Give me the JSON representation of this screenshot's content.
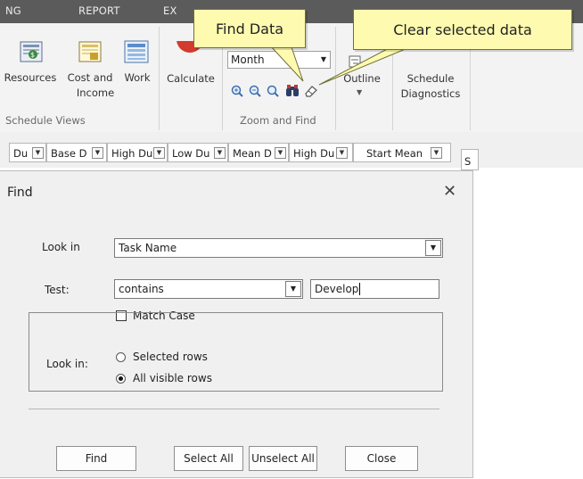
{
  "ribbon": {
    "tabs": [
      "NG",
      "REPORT",
      "EX"
    ],
    "buttons": {
      "resources": "Resources",
      "cost_income_line1": "Cost and",
      "cost_income_line2": "Income",
      "work": "Work",
      "calculate": "Calculate",
      "timescale_value": "Month",
      "outline": "Outline",
      "schedule_diag_line1": "Schedule",
      "schedule_diag_line2": "Diagnostics"
    },
    "groups": {
      "schedule_views": "Schedule Views",
      "zoom_find": "Zoom and Find"
    },
    "icons": [
      "resources-icon",
      "cost-income-icon",
      "work-icon",
      "calculate-icon",
      "zoom-in-icon",
      "zoom-out-icon",
      "zoom-fit-icon",
      "find-binoculars-icon",
      "eraser-icon",
      "outline-icon"
    ]
  },
  "callouts": {
    "find_data": "Find Data",
    "clear_selected": "Clear selected data"
  },
  "columns": [
    "Du",
    "Base D",
    "High Du",
    "Low Du",
    "Mean D",
    "High Du",
    "Start Mean",
    "S"
  ],
  "dialog": {
    "title": "Find",
    "look_in_label": "Look in",
    "look_in_value": "Task Name",
    "test_label": "Test:",
    "test_value": "contains",
    "search_value": "Develop",
    "match_case_label": "Match Case",
    "match_case_checked": false,
    "scope_label": "Look in:",
    "scope_options": [
      {
        "label": "Selected rows",
        "selected": false
      },
      {
        "label": "All visible rows",
        "selected": true
      }
    ],
    "buttons": {
      "find": "Find",
      "select_all": "Select All",
      "unselect_all": "Unselect All",
      "close": "Close"
    }
  }
}
